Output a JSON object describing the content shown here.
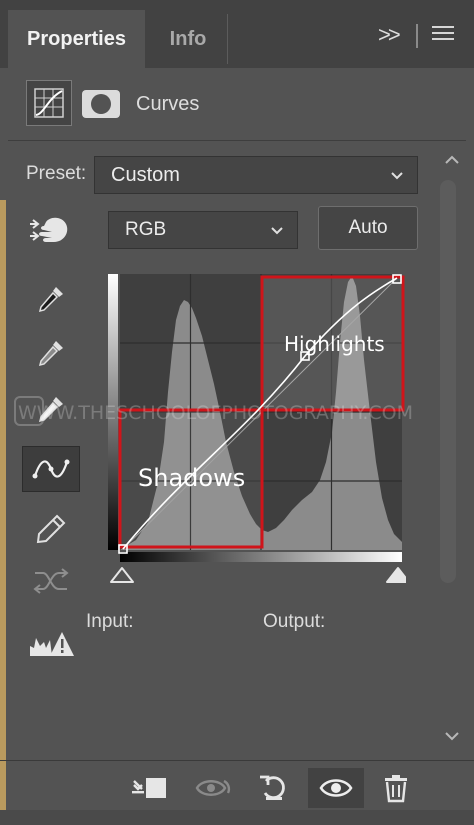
{
  "tabs": [
    {
      "label": "Properties",
      "active": true
    },
    {
      "label": "Info",
      "active": false
    }
  ],
  "panel": {
    "expand_glyph": ">>",
    "title": "Curves"
  },
  "preset": {
    "label": "Preset:",
    "value": "Custom"
  },
  "channel": {
    "value": "RGB",
    "auto_label": "Auto"
  },
  "tools": [
    {
      "icon": "eyedropper-black-icon"
    },
    {
      "icon": "eyedropper-gray-icon"
    },
    {
      "icon": "eyedropper-white-icon"
    },
    {
      "icon": "curve-points-icon",
      "active": true
    },
    {
      "icon": "pencil-icon"
    },
    {
      "icon": "smooth-curve-icon",
      "disabled": true
    },
    {
      "icon": "clipping-warning-icon"
    }
  ],
  "annotations": {
    "highlights": "Highlights",
    "shadows": "Shadows",
    "highlight_box_color": "#d0141a",
    "shadow_box_color": "#d0141a"
  },
  "watermark": "WWW.THESCHOOLOFPHOTOGRAPHY.COM",
  "io": {
    "input_label": "Input:",
    "output_label": "Output:"
  },
  "bottom_toolbar": [
    {
      "icon": "clip-to-layer-icon"
    },
    {
      "icon": "view-previous-state-icon",
      "disabled": true
    },
    {
      "icon": "reset-icon"
    },
    {
      "icon": "visibility-eye-icon",
      "active": true
    },
    {
      "icon": "trash-icon"
    }
  ],
  "colors": {
    "panel_bg": "#535353",
    "tabbar_bg": "#424242",
    "accent_red": "#d0141a"
  }
}
